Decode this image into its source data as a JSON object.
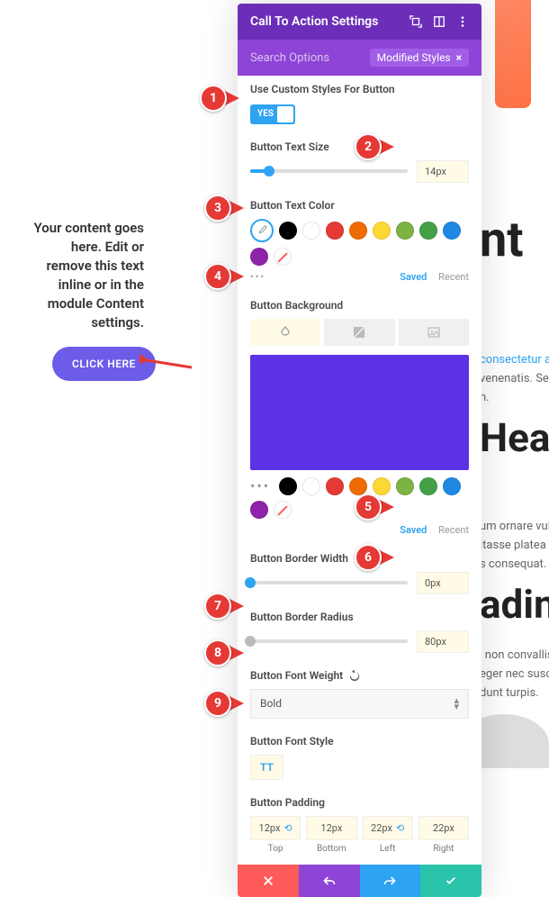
{
  "panel": {
    "title": "Call To Action Settings",
    "search_placeholder": "Search Options",
    "filter_pill": "Modified Styles"
  },
  "settings": {
    "custom_styles_label": "Use Custom Styles For Button",
    "custom_styles_value": "YES",
    "text_size_label": "Button Text Size",
    "text_size_value": "14px",
    "text_color_label": "Button Text Color",
    "bg_label": "Button Background",
    "border_width_label": "Button Border Width",
    "border_width_value": "0px",
    "border_radius_label": "Button Border Radius",
    "border_radius_value": "80px",
    "font_weight_label": "Button Font Weight",
    "font_weight_value": "Bold",
    "font_style_label": "Button Font Style",
    "font_style_value": "TT",
    "padding_label": "Button Padding",
    "padding": {
      "top_v": "12px",
      "top_l": "Top",
      "bottom_v": "12px",
      "bottom_l": "Bottom",
      "left_v": "22px",
      "left_l": "Left",
      "right_v": "22px",
      "right_l": "Right"
    }
  },
  "swatch_footer": {
    "saved": "Saved",
    "recent": "Recent"
  },
  "colors_text": [
    "#000000",
    "#ffffff",
    "#e53935",
    "#ef6c00",
    "#fdd835",
    "#7cb342",
    "#43a047",
    "#1e88e5",
    "#8e24aa"
  ],
  "colors_bg": [
    "#000000",
    "#ffffff",
    "#e53935",
    "#ef6c00",
    "#fdd835",
    "#7cb342",
    "#43a047",
    "#1e88e5",
    "#8e24aa"
  ],
  "callouts": [
    "1",
    "2",
    "3",
    "4",
    "5",
    "6",
    "7",
    "8",
    "9"
  ],
  "page": {
    "content_text": "Your content goes here. Edit or remove this text inline or in the module Content settings.",
    "button": "CLICK HERE",
    "big_nt": "nt",
    "hea": "Hea",
    "adin": "adin",
    "para1_a": "consectetur adip",
    "para1_b": "venenatis. Sed",
    "para1_c": "n.",
    "para2_a": "um ornare vulp",
    "para2_b": "itasse platea di",
    "para2_c": "s consequat.",
    "para3_a": ", non convallis l",
    "para3_b": "eger nec suscipi",
    "para3_c": "dunt turpis."
  }
}
